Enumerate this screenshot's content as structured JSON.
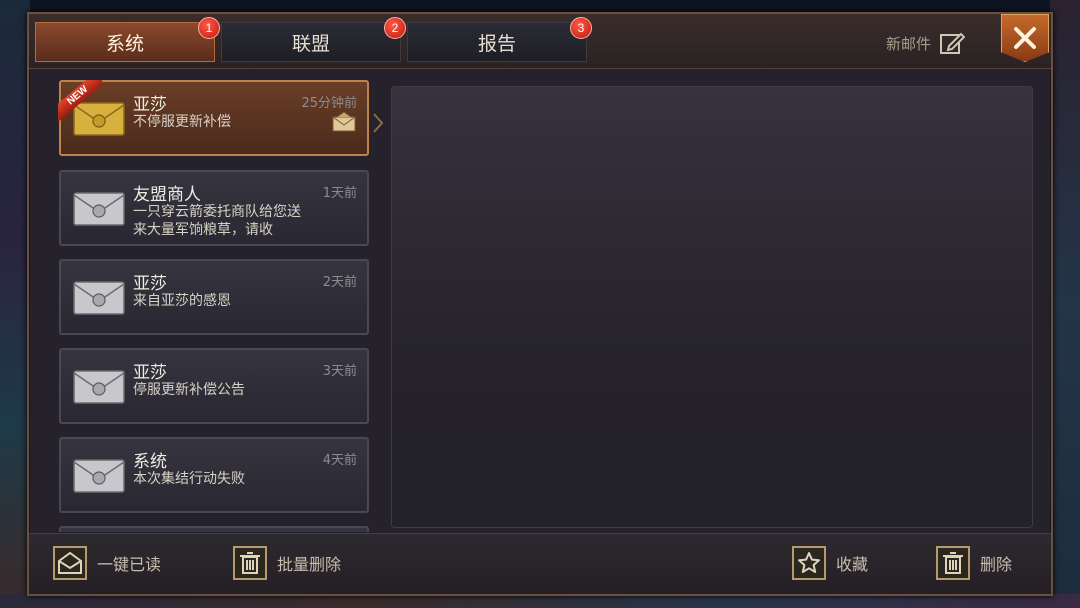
{
  "tabs": [
    {
      "label": "系统",
      "badge": "1",
      "active": true
    },
    {
      "label": "联盟",
      "badge": "2",
      "active": false
    },
    {
      "label": "报告",
      "badge": "3",
      "active": false
    }
  ],
  "header": {
    "new_mail_label": "新邮件"
  },
  "mails": [
    {
      "sender": "亚莎",
      "preview": "不停服更新补偿",
      "time": "25分钟前",
      "is_new": true,
      "new_label": "NEW",
      "selected": true,
      "has_attachment": true
    },
    {
      "sender": "友盟商人",
      "preview": "一只穿云箭委托商队给您送来大量军饷粮草，请收",
      "time": "1天前",
      "is_new": false,
      "selected": false
    },
    {
      "sender": "亚莎",
      "preview": "来自亚莎的感恩",
      "time": "2天前",
      "is_new": false,
      "selected": false
    },
    {
      "sender": "亚莎",
      "preview": "停服更新补偿公告",
      "time": "3天前",
      "is_new": false,
      "selected": false
    },
    {
      "sender": "系统",
      "preview": "本次集结行动失败",
      "time": "4天前",
      "is_new": false,
      "selected": false
    }
  ],
  "footer": {
    "read_all_label": "一键已读",
    "batch_delete_label": "批量删除",
    "favorite_label": "收藏",
    "delete_label": "删除"
  },
  "colors": {
    "accent_active_tab": "#8a4a2c",
    "selected_item_border": "#c0824a",
    "badge_red": "#c01810",
    "envelope_gold": "#d8b040",
    "envelope_silver": "#c8c8cc"
  },
  "icons": {
    "new_mail": "edit-icon",
    "close": "close-icon",
    "read_all": "envelope-open-icon",
    "batch_delete": "trash-icon",
    "favorite": "star-icon",
    "delete": "trash-icon"
  }
}
